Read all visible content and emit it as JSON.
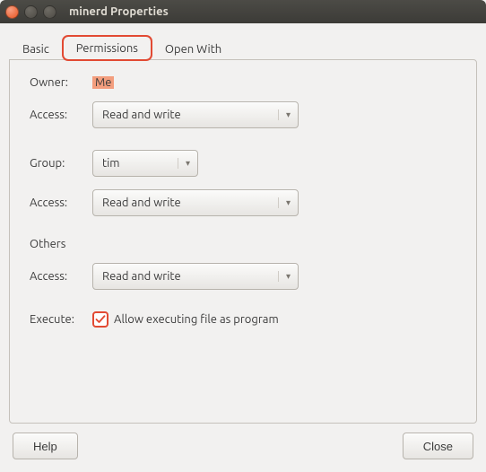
{
  "window": {
    "title": "minerd Properties"
  },
  "tabs": {
    "basic": "Basic",
    "permissions": "Permissions",
    "openwith": "Open With"
  },
  "perm": {
    "owner_label": "Owner:",
    "owner_value": "Me",
    "access_label": "Access:",
    "owner_access": "Read and write",
    "group_label": "Group:",
    "group_value": "tim",
    "group_access": "Read and write",
    "others_label": "Others",
    "others_access": "Read and write",
    "execute_label": "Execute:",
    "execute_text": "Allow executing file as program"
  },
  "buttons": {
    "help": "Help",
    "close": "Close"
  }
}
